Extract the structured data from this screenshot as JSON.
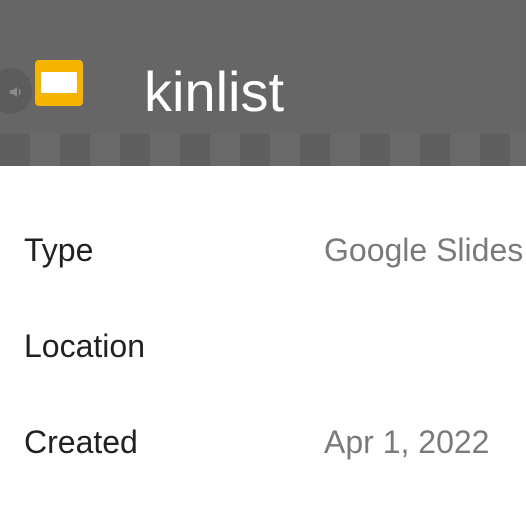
{
  "header": {
    "title": "kinlist",
    "file_icon": "google-slides-icon",
    "side_icon": "speaker-icon"
  },
  "details": [
    {
      "label": "Type",
      "value": "Google Slides"
    },
    {
      "label": "Location",
      "value": ""
    },
    {
      "label": "Created",
      "value": "Apr 1, 2022"
    }
  ],
  "colors": {
    "header_bg": "#666666",
    "slides_icon": "#f5b400",
    "label_text": "#212121",
    "value_text": "#7a7a7a"
  }
}
